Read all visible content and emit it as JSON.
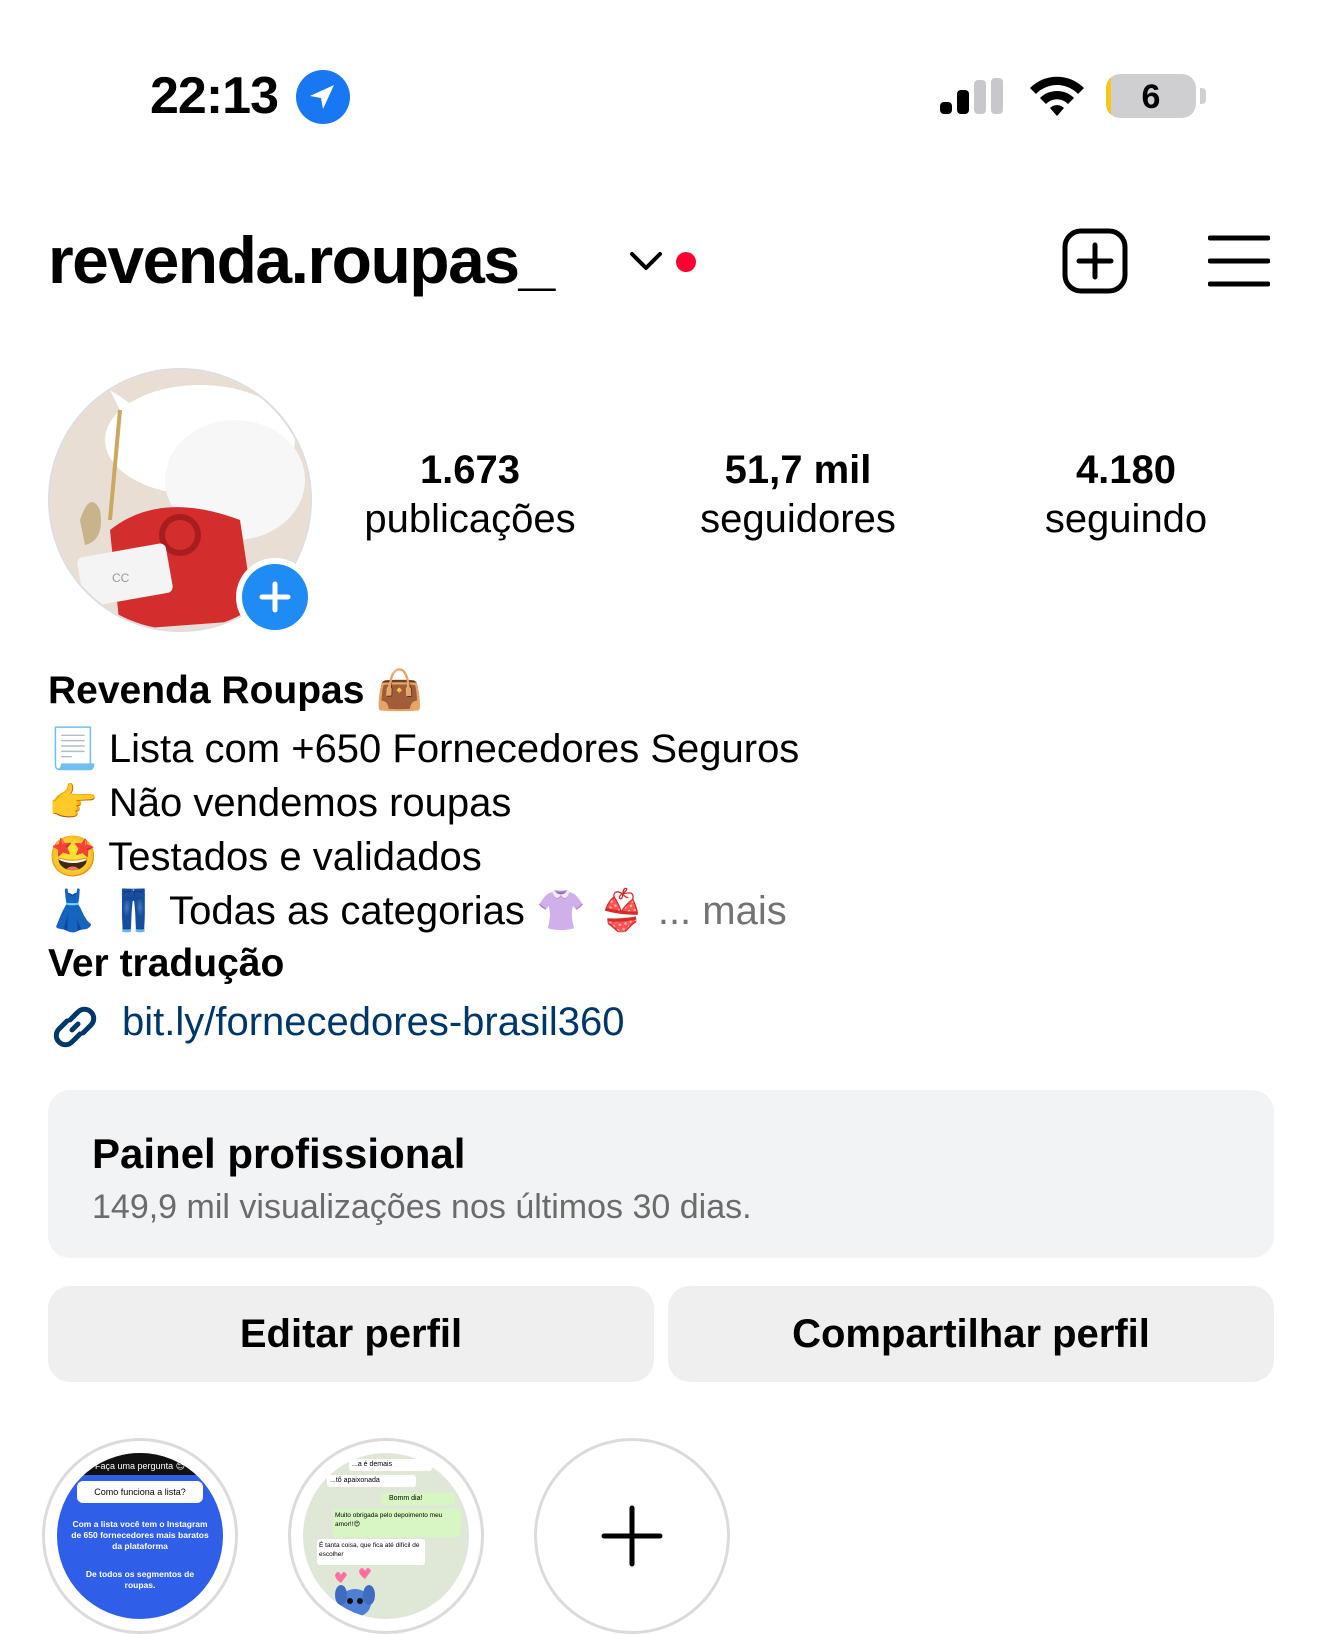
{
  "status_bar": {
    "time": "22:13",
    "battery_level": "6",
    "battery_fraction": 0.06,
    "location_icon": "location-arrow-icon",
    "signal_icon": "cellular-signal-icon",
    "wifi_icon": "wifi-icon"
  },
  "header": {
    "username": "revenda.roupas_",
    "dropdown_icon": "chevron-down-icon",
    "notification_dot_color": "#ff0033",
    "add_icon": "add-post-icon",
    "menu_icon": "hamburger-menu-icon"
  },
  "profile": {
    "stats": [
      {
        "value": "1.673",
        "label": "publicações"
      },
      {
        "value": "51,7 mil",
        "label": "seguidores"
      },
      {
        "value": "4.180",
        "label": "seguindo"
      }
    ]
  },
  "bio": {
    "name": "Revenda Roupas 👜",
    "lines": [
      "📃 Lista com +650 Fornecedores Seguros",
      "👉 Não vendemos roupas",
      "🤩 Testados e validados",
      "👗 👖 Todas as categorias 👚 👙"
    ],
    "more": " ... mais",
    "translate": "Ver tradução",
    "link": "bit.ly/fornecedores-brasil360"
  },
  "panel": {
    "title": "Painel profissional",
    "subtitle": "149,9 mil visualizações nos últimos 30 dias."
  },
  "buttons": {
    "edit": "Editar perfil",
    "share": "Compartilhar perfil"
  },
  "highlights": {
    "first": {
      "top_text": "Faça uma pergunta 😊",
      "question": "Como funciona a lista?",
      "answer1": "Com a lista você tem o Instagram de 650 fornecedores mais baratos da plataforma",
      "answer2": "De todos os segmentos de roupas."
    },
    "second": {
      "msg1": "...a é demais",
      "msg2": "...tô apaixonada",
      "msg3": "Bomm dia!",
      "msg4": "Muito obrigada pelo depoimento meu amor!!😍",
      "msg5": "É tanta coisa, que fica até difícil de escolher"
    },
    "new_icon": "plus-icon"
  },
  "colors": {
    "accent_blue": "#1f8bf5",
    "link_blue": "#00376b",
    "panel_bg": "#f2f3f5",
    "button_bg": "#efefef"
  }
}
